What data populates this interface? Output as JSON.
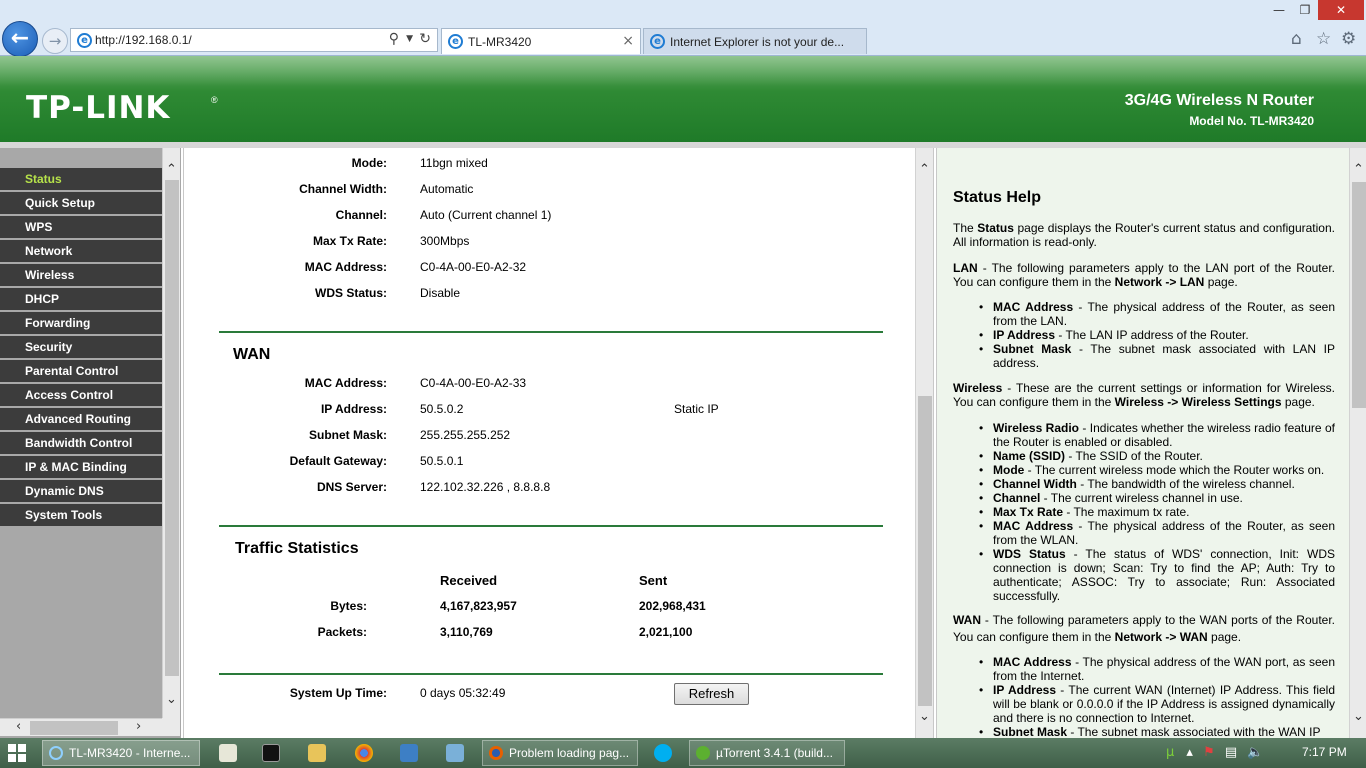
{
  "browser": {
    "address_url": "http://192.168.0.1/",
    "tabs": [
      {
        "label": "TL-MR3420"
      },
      {
        "label": "Internet Explorer is not your de..."
      }
    ],
    "tab_close_glyph": "×",
    "icons": [
      "back-icon",
      "forward-icon",
      "search-icon",
      "refresh-icon",
      "home-icon",
      "favorites-star-icon",
      "settings-gear-icon"
    ]
  },
  "header": {
    "logo": "TP-LINK",
    "product_name": "3G/4G Wireless N Router",
    "model": "Model No. TL-MR3420",
    "colors": {
      "primary": "#2f8a34",
      "menu_active": "#b6e24a",
      "menu_bg": "#3c3c3c"
    }
  },
  "menu": {
    "items": [
      {
        "label": "Status",
        "active": true
      },
      {
        "label": "Quick Setup"
      },
      {
        "label": "WPS"
      },
      {
        "label": "Network"
      },
      {
        "label": "Wireless"
      },
      {
        "label": "DHCP"
      },
      {
        "label": "Forwarding"
      },
      {
        "label": "Security"
      },
      {
        "label": "Parental Control"
      },
      {
        "label": "Access Control"
      },
      {
        "label": "Advanced Routing"
      },
      {
        "label": "Bandwidth Control"
      },
      {
        "label": "IP & MAC Binding"
      },
      {
        "label": "Dynamic DNS"
      },
      {
        "label": "System Tools"
      }
    ]
  },
  "status": {
    "wireless": [
      {
        "label": "Mode:",
        "value": "11bgn mixed"
      },
      {
        "label": "Channel Width:",
        "value": "Automatic"
      },
      {
        "label": "Channel:",
        "value": "Auto (Current channel 1)"
      },
      {
        "label": "Max Tx Rate:",
        "value": "300Mbps"
      },
      {
        "label": "MAC Address:",
        "value": "C0-4A-00-E0-A2-32"
      },
      {
        "label": "WDS Status:",
        "value": "Disable"
      }
    ],
    "wan": {
      "title": "WAN",
      "rows": [
        {
          "label": "MAC Address:",
          "value": "C0-4A-00-E0-A2-33"
        },
        {
          "label": "IP Address:",
          "value": "50.5.0.2",
          "extra": "Static IP"
        },
        {
          "label": "Subnet Mask:",
          "value": "255.255.255.252"
        },
        {
          "label": "Default Gateway:",
          "value": "50.5.0.1"
        },
        {
          "label": "DNS Server:",
          "value": "122.102.32.226 , 8.8.8.8"
        }
      ]
    },
    "traffic": {
      "title": "Traffic Statistics",
      "received_header": "Received",
      "sent_header": "Sent",
      "rows": [
        {
          "label": "Bytes:",
          "received": "4,167,823,957",
          "sent": "202,968,431"
        },
        {
          "label": "Packets:",
          "received": "3,110,769",
          "sent": "2,021,100"
        }
      ]
    },
    "uptime_label": "System Up Time:",
    "uptime_value": "0 days 05:32:49",
    "refresh_label": "Refresh"
  },
  "help": {
    "title": "Status Help",
    "intro_pre": "The ",
    "intro_bold": "Status",
    "intro_post": " page displays the Router's current status and configuration. All information is read-only.",
    "lan": {
      "term": "LAN",
      "text_pre": " - The following parameters apply to the LAN port of the Router. You can configure them in the ",
      "link": "Network -> LAN",
      "text_post": " page.",
      "items": [
        {
          "term": "MAC Address",
          "desc": " - The physical address of the Router, as seen from the LAN."
        },
        {
          "term": "IP Address",
          "desc": " - The LAN IP address of the Router."
        },
        {
          "term": "Subnet Mask",
          "desc": " - The subnet mask associated with LAN IP address."
        }
      ]
    },
    "wireless": {
      "term": "Wireless",
      "text_pre": " - These are the current settings or information for Wireless. You can configure them in the ",
      "link": "Wireless -> Wireless Settings",
      "text_post": " page.",
      "items": [
        {
          "term": "Wireless Radio",
          "desc": " - Indicates whether the wireless radio feature of the Router is enabled or disabled."
        },
        {
          "term": "Name (SSID)",
          "desc": " - The SSID of the Router."
        },
        {
          "term": "Mode",
          "desc": " - The current wireless mode which the Router works on."
        },
        {
          "term": "Channel Width",
          "desc": " - The bandwidth of the wireless channel."
        },
        {
          "term": "Channel",
          "desc": " - The current wireless channel in use."
        },
        {
          "term": "Max Tx Rate",
          "desc": " - The maximum tx rate."
        },
        {
          "term": "MAC Address",
          "desc": " - The physical address of the Router, as seen from the WLAN."
        },
        {
          "term": "WDS Status",
          "desc": " - The status of WDS' connection, Init: WDS connection is down; Scan: Try to find the AP; Auth: Try to authenticate; ASSOC: Try to associate; Run: Associated successfully."
        }
      ]
    },
    "wan": {
      "term": "WAN",
      "text_pre": " - The following parameters apply to the WAN ports of the Router. You can configure them in the ",
      "link": "Network -> WAN",
      "text_post": " page.",
      "items": [
        {
          "term": "MAC Address",
          "desc": " - The physical address of the WAN port, as seen from the Internet."
        },
        {
          "term": "IP Address",
          "desc": " - The current WAN (Internet) IP Address. This field will be blank or 0.0.0.0 if the IP Address is assigned dynamically and there is no connection to Internet."
        },
        {
          "term": "Subnet Mask",
          "desc": " - The subnet mask associated with the WAN IP"
        }
      ]
    }
  },
  "taskbar": {
    "tasks": [
      {
        "label": "TL-MR3420 - Interne..."
      },
      {
        "label": "Problem loading pag..."
      },
      {
        "label": "µTorrent 3.4.1  (build..."
      }
    ],
    "clock": "7:17 PM"
  }
}
